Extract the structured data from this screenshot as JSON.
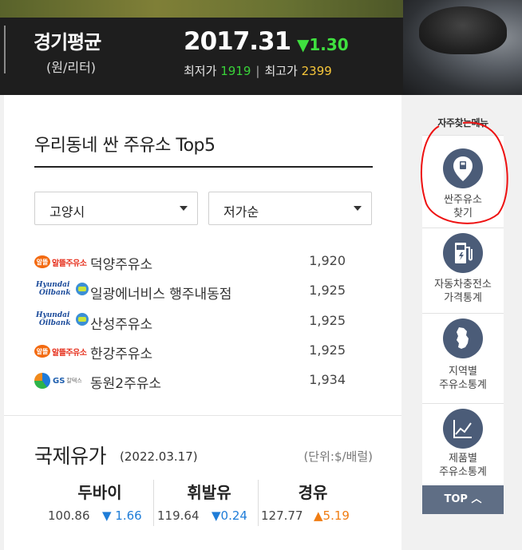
{
  "header": {
    "title": "경기평균",
    "unit": "(원/리터)",
    "price": "2017.31",
    "change": "▼1.30",
    "min_label": "최저가",
    "min_value": "1919",
    "max_label": "최고가",
    "max_value": "2399",
    "colors": {
      "down": "#3fe03f",
      "min": "#39d239",
      "max": "#f5c53a"
    }
  },
  "top5": {
    "title": "우리동네 싼 주유소 Top5",
    "city_select": "고양시",
    "sort_select": "저가순",
    "stations": [
      {
        "brand": "알뜰주유소",
        "logo_icon": "altteul-logo-icon",
        "name": "덕양주유소",
        "price": "1,920"
      },
      {
        "brand": "Hyundai Oilbank",
        "logo_icon": "hyundai-oilbank-logo-icon",
        "name": "일광에너비스 행주내동점",
        "price": "1,925"
      },
      {
        "brand": "Hyundai Oilbank",
        "logo_icon": "hyundai-oilbank-logo-icon",
        "name": "산성주유소",
        "price": "1,925"
      },
      {
        "brand": "알뜰주유소",
        "logo_icon": "altteul-logo-icon",
        "name": "한강주유소",
        "price": "1,925"
      },
      {
        "brand": "GS칼텍스",
        "logo_icon": "gs-caltex-logo-icon",
        "name": "동원2주유소",
        "price": "1,934"
      }
    ]
  },
  "intl_oil": {
    "title": "국제유가",
    "date": "(2022.03.17)",
    "unit": "(단위:$/배럴)",
    "items": [
      {
        "name": "두바이",
        "price": "100.86",
        "change": "▼ 1.66",
        "direction": "down"
      },
      {
        "name": "휘발유",
        "price": "119.64",
        "change": "▼0.24",
        "direction": "down"
      },
      {
        "name": "경유",
        "price": "127.77",
        "change": "▲5.19",
        "direction": "up"
      }
    ]
  },
  "rail": {
    "heading": "자주찾는메뉴",
    "items": [
      {
        "label": "싼주유소\n찾기",
        "icon": "fuel-pin-icon"
      },
      {
        "label": "자동차충전소\n가격통계",
        "icon": "charging-station-icon"
      },
      {
        "label": "지역별\n주유소통계",
        "icon": "korea-map-icon"
      },
      {
        "label": "제품별\n주유소통계",
        "icon": "line-chart-icon"
      }
    ],
    "top_button": "TOP"
  }
}
